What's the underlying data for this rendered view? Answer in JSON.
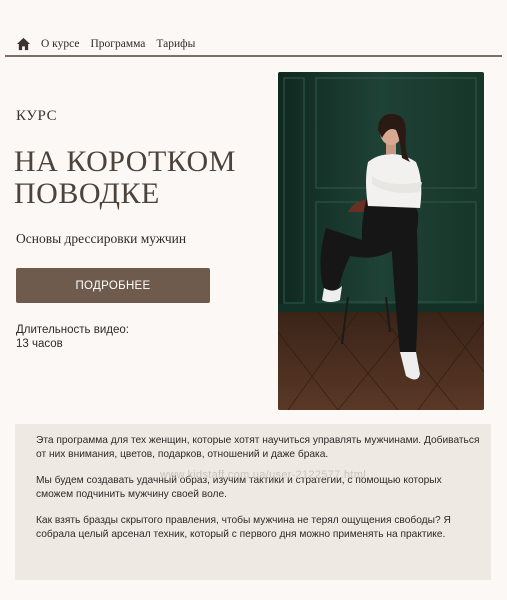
{
  "nav": {
    "home_icon": "home-icon",
    "items": [
      {
        "label": "О курсе"
      },
      {
        "label": "Программа"
      },
      {
        "label": "Тарифы"
      }
    ]
  },
  "hero": {
    "kicker": "КУРС",
    "title": "НА КОРОТКОМ ПОВОДКЕ",
    "subtitle": "Основы дрессировки мужчин",
    "cta_label": "ПОДРОБНЕЕ",
    "duration_label": "Длительность видео:",
    "duration_value": "13 часов"
  },
  "description": {
    "paragraph_1": "Эта программа для тех женщин, которые хотят научиться управлять мужчинами. Добиваться от них внимания, цветов, подарков, отношений и даже брака.",
    "paragraph_2": "Мы будем создавать удачный образ, изучим тактики и стратегии, с помощью которых сможем подчинить мужчину своей воле.",
    "paragraph_3": "Как взять бразды скрытого правления, чтобы мужчина не терял ощущения свободы? Я собрала целый арсенал техник, который с первого дня можно применять на практике."
  },
  "watermark": "www.kidstaff.com.ua/user-2122577.html",
  "colors": {
    "background": "#fbf8f6",
    "button": "#6e5b4e",
    "title": "#4e433b",
    "textbox": "#efe9e4",
    "photo_wall": "#1c3a30"
  }
}
